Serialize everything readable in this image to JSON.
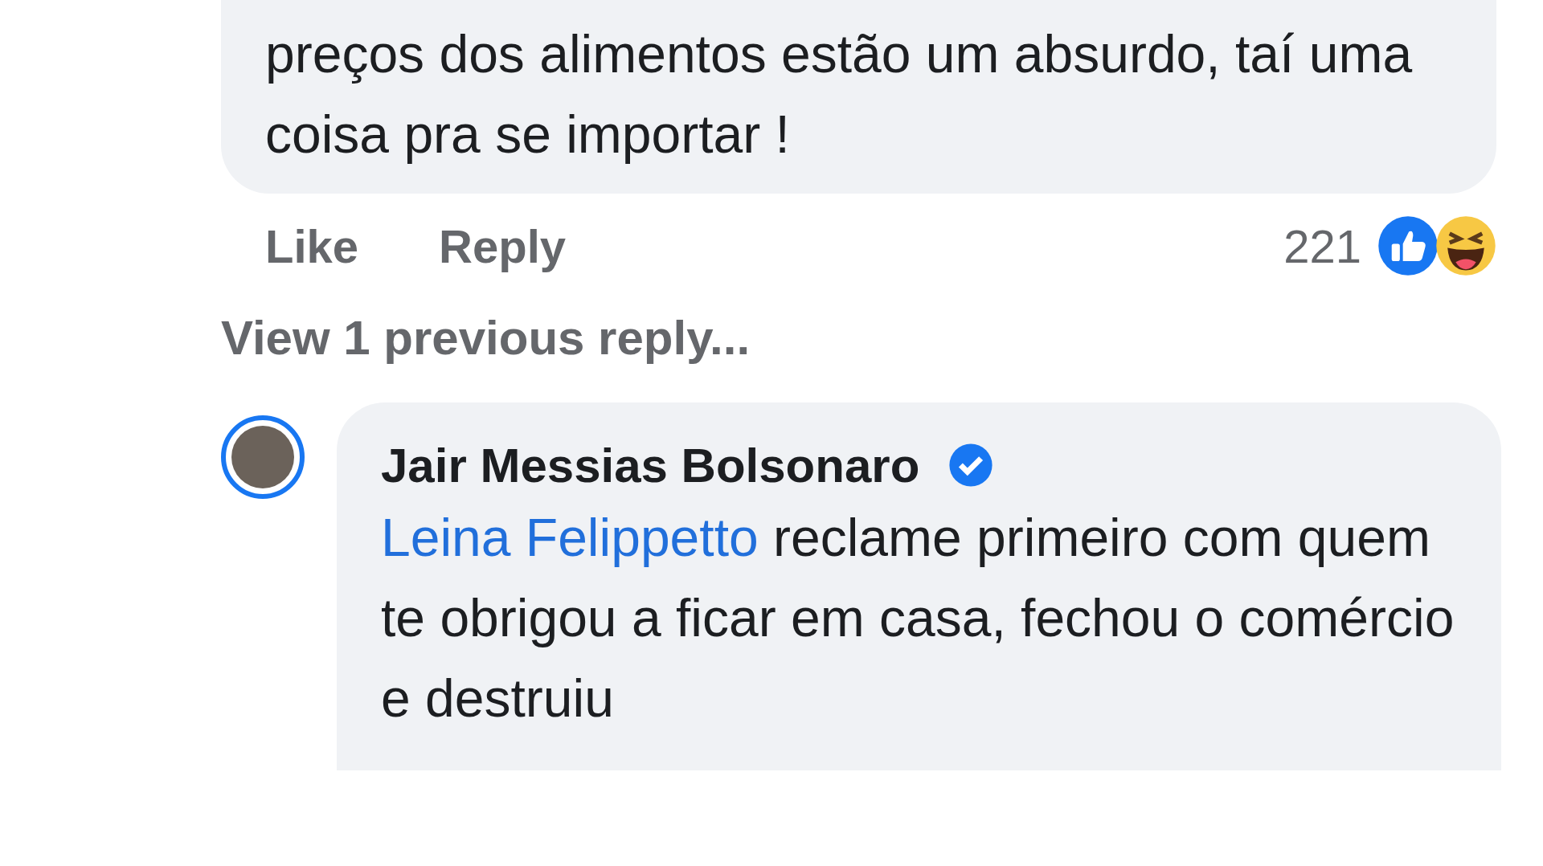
{
  "parent_comment": {
    "text": "preços dos alimentos estão um absurdo, taí uma coisa pra se importar !",
    "actions": [
      {
        "label": "Like"
      },
      {
        "label": "Reply"
      }
    ],
    "reaction_count": "221"
  },
  "view_previous": "View 1 previous reply...",
  "reply": {
    "author": "Jair Messias Bolsonaro",
    "verified": true,
    "mention": "Leina Felippetto",
    "text": "reclame primeiro com quem te obrigou a ficar em casa, fechou o comércio e destruiu"
  }
}
